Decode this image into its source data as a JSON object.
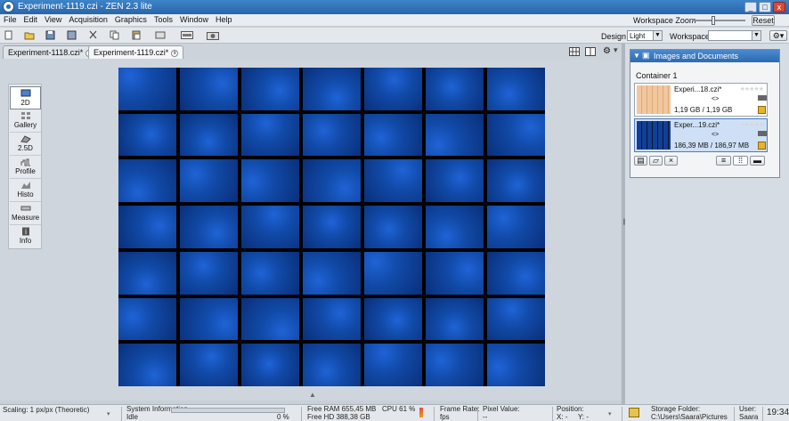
{
  "window": {
    "title": "Experiment-1119.czi - ZEN 2.3 lite",
    "min_label": "_",
    "max_label": "□",
    "close_label": "x"
  },
  "menubar": {
    "items": [
      "File",
      "Edit",
      "View",
      "Acquisition",
      "Graphics",
      "Tools",
      "Window",
      "Help"
    ],
    "workspace_zoom_label": "Workspace Zoom",
    "reset_label": "Reset"
  },
  "toolbar": {
    "design_label": "Design",
    "design_value": "Light",
    "workspace_label": "Workspace",
    "workspace_value": ""
  },
  "tabs": [
    {
      "label": "Experiment-1118.czi*",
      "active": false
    },
    {
      "label": "Experiment-1119.czi*",
      "active": true
    }
  ],
  "leftnav": {
    "items": [
      "2D",
      "Gallery",
      "2.5D",
      "Profile",
      "Histo",
      "Measure",
      "Info"
    ],
    "active": "2D"
  },
  "image": {
    "rows": 7,
    "cols": 7,
    "color": "#1048b0"
  },
  "images_panel": {
    "title": "Images and Documents",
    "container_label": "Container 1",
    "documents": [
      {
        "name": "Experi...18.czi*",
        "size": "1,19 GB / 1,19 GB",
        "selected": false
      },
      {
        "name": "Exper...19.czi*",
        "size": "186,39 MB / 186,97 MB",
        "selected": true
      }
    ]
  },
  "statusbar": {
    "scaling": "Scaling: 1 px/px (Theoretic)",
    "sys_info_label": "System Information",
    "sys_info_value": "Idle",
    "progress_percent": "0 %",
    "free_ram": "Free RAM 655,45 MB",
    "free_hd": "Free HD 388,38 GB",
    "cpu": "CPU 61 %",
    "frame_rate_label": "Frame Rate:",
    "frame_rate_value": "fps",
    "pixel_value_label": "Pixel Value:",
    "pixel_value_value": "--",
    "position_label": "Position:",
    "position_x": "X: -",
    "position_y": "Y: -",
    "storage_label": "Storage Folder:",
    "storage_value": "C:\\Users\\Saara\\Pictures",
    "user_label": "User:",
    "user_value": "Saara",
    "time": "19:34"
  }
}
